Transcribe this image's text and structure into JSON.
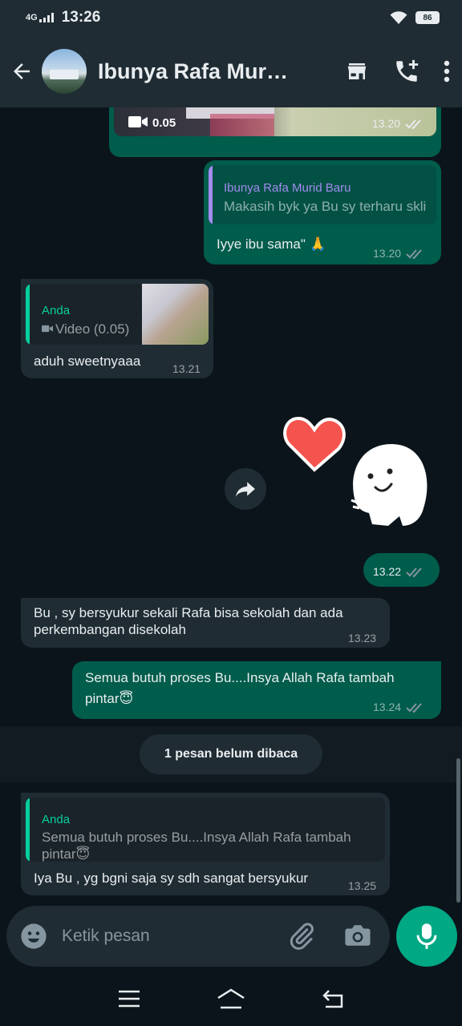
{
  "status": {
    "network": "4G",
    "time": "13:26",
    "battery": "86"
  },
  "header": {
    "contact_name": "Ibunya Rafa Murid Baru"
  },
  "messages": {
    "video_bubble": {
      "duration": "0.05",
      "time": "13.20"
    },
    "msg1": {
      "quote_name": "Ibunya Rafa Murid Baru",
      "quote_text": "Makasih byk ya Bu sy terharu skli",
      "text": "Iyye ibu sama\" 🙏",
      "time": "13.20"
    },
    "msg2": {
      "quote_name": "Anda",
      "quote_text": "Video (0.05)",
      "text": "aduh sweetnyaaa",
      "time": "13.21"
    },
    "sticker": {
      "time": "13.22"
    },
    "msg3": {
      "text": "Bu , sy bersyukur sekali Rafa bisa sekolah dan ada perkembangan disekolah",
      "time": "13.23"
    },
    "msg4": {
      "text": "Semua butuh proses Bu....Insya Allah Rafa tambah pintar😇",
      "time": "13.24"
    },
    "unread": "1 pesan belum dibaca",
    "msg5": {
      "quote_name": "Anda",
      "quote_text": "Semua butuh proses Bu....Insya Allah Rafa tambah pintar😇",
      "text": "Iya Bu , yg bgni saja sy sdh sangat bersyukur",
      "time": "13.25"
    }
  },
  "input": {
    "placeholder": "Ketik pesan"
  },
  "colors": {
    "accent": "#00a884",
    "outgoing": "#005c4b",
    "incoming": "#1f2c34",
    "read_tick": "#8696a0",
    "quote_name_out": "#a38bf0",
    "quote_name_in": "#06cf9c"
  },
  "icons": [
    "back-arrow-icon",
    "store-icon",
    "add-call-icon",
    "more-vertical-icon",
    "video-camera-icon",
    "double-check-icon",
    "forward-icon",
    "emoji-icon",
    "attach-icon",
    "camera-icon",
    "mic-icon",
    "nav-menu-icon",
    "nav-home-icon",
    "nav-back-icon"
  ]
}
